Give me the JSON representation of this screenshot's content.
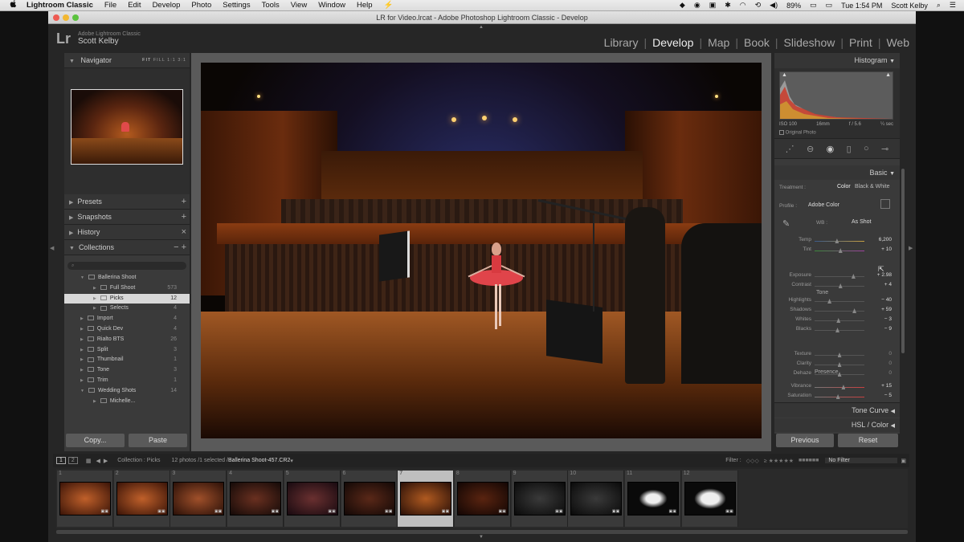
{
  "menubar": {
    "apple": "",
    "app_name": "Lightroom Classic",
    "menus": [
      "File",
      "Edit",
      "Develop",
      "Photo",
      "Settings",
      "Tools",
      "View",
      "Window",
      "Help"
    ],
    "battery": "89%",
    "clock": "Tue 1:54 PM",
    "user": "Scott Kelby"
  },
  "window": {
    "title": "LR for Video.lrcat - Adobe Photoshop Lightroom Classic - Develop"
  },
  "identity": {
    "logo": "Lr",
    "product": "Adobe Lightroom Classic",
    "user": "Scott Kelby"
  },
  "modules": {
    "items": [
      "Library",
      "Develop",
      "Map",
      "Book",
      "Slideshow",
      "Print",
      "Web"
    ],
    "active": "Develop"
  },
  "navigator": {
    "title": "Navigator",
    "zoom_options": [
      "FIT",
      "FILL",
      "1:1",
      "3:1"
    ]
  },
  "left_panels": {
    "presets": "Presets",
    "snapshots": "Snapshots",
    "history": "History",
    "collections": "Collections"
  },
  "collections": [
    {
      "name": "Ballerina Shoot",
      "count": "",
      "level": 1
    },
    {
      "name": "Full Shoot",
      "count": "573",
      "level": 2
    },
    {
      "name": "Picks",
      "count": "12",
      "level": 2,
      "selected": true
    },
    {
      "name": "Selects",
      "count": "4",
      "level": 2
    },
    {
      "name": "Import",
      "count": "4",
      "level": 1
    },
    {
      "name": "Quick Dev",
      "count": "4",
      "level": 1
    },
    {
      "name": "Rialto BTS",
      "count": "26",
      "level": 1
    },
    {
      "name": "Split",
      "count": "3",
      "level": 1
    },
    {
      "name": "Thumbnail",
      "count": "1",
      "level": 1
    },
    {
      "name": "Tone",
      "count": "3",
      "level": 1
    },
    {
      "name": "Trim",
      "count": "1",
      "level": 1
    },
    {
      "name": "Wedding Shots",
      "count": "14",
      "level": 1
    },
    {
      "name": "Michelle...",
      "count": "",
      "level": 2
    }
  ],
  "left_buttons": {
    "copy": "Copy...",
    "paste": "Paste"
  },
  "histogram": {
    "title": "Histogram",
    "iso": "ISO 100",
    "focal": "16mm",
    "aperture": "f / 5.6",
    "shutter": "¼ sec",
    "original_photo": "Original Photo"
  },
  "basic": {
    "title": "Basic",
    "treatment_label": "Treatment :",
    "treatment_color": "Color",
    "treatment_bw": "Black & White",
    "profile_label": "Profile :",
    "profile_value": "Adobe Color",
    "wb_label": "WB :",
    "wb_value": "As Shot",
    "tone_label": "Tone",
    "presence_label": "Presence",
    "sliders": [
      {
        "label": "Temp",
        "value": "6,200",
        "pos": 0.45
      },
      {
        "label": "Tint",
        "value": "+ 10",
        "pos": 0.52
      },
      {
        "label": "Exposure",
        "value": "+ 2.98",
        "pos": 0.78
      },
      {
        "label": "Contrast",
        "value": "+ 4",
        "pos": 0.52
      },
      {
        "label": "Highlights",
        "value": "− 40",
        "pos": 0.3
      },
      {
        "label": "Shadows",
        "value": "+ 59",
        "pos": 0.8
      },
      {
        "label": "Whites",
        "value": "− 3",
        "pos": 0.48
      },
      {
        "label": "Blacks",
        "value": "− 9",
        "pos": 0.46
      },
      {
        "label": "Texture",
        "value": "0",
        "pos": 0.5
      },
      {
        "label": "Clarity",
        "value": "0",
        "pos": 0.5
      },
      {
        "label": "Dehaze",
        "value": "0",
        "pos": 0.5
      },
      {
        "label": "Vibrance",
        "value": "+ 15",
        "pos": 0.58
      },
      {
        "label": "Saturation",
        "value": "− 5",
        "pos": 0.47
      }
    ]
  },
  "right_panels": {
    "tone_curve": "Tone Curve",
    "hsl": "HSL / Color"
  },
  "right_buttons": {
    "previous": "Previous",
    "reset": "Reset"
  },
  "filmstrip": {
    "view1": "1",
    "view2": "2",
    "source": "Collection : Picks",
    "info": "12 photos /1 selected /",
    "filename": "Ballerina Shoot-457.CR2",
    "filter_label": "Filter :",
    "filter_value": "No Filter",
    "selected_index": 7,
    "thumbs": [
      "1",
      "2",
      "3",
      "4",
      "5",
      "6",
      "7",
      "8",
      "9",
      "10",
      "11",
      "12"
    ]
  },
  "colors": {
    "bg": "#262626",
    "panel": "#3a3a3a",
    "selected": "#d8d8d8"
  }
}
